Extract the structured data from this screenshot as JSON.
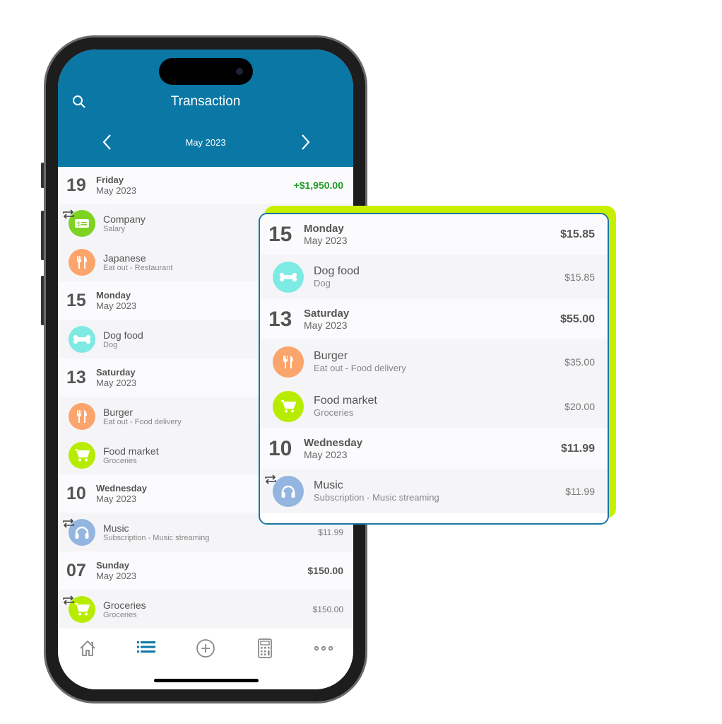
{
  "header": {
    "title": "Transaction",
    "month": "May 2023"
  },
  "colors": {
    "header": "#0a77a5",
    "accent": "#c7f000",
    "income": "#1e9a2a"
  },
  "phone_list": [
    {
      "type": "day",
      "num": "19",
      "name": "Friday",
      "sub": "May 2023",
      "amount": "+$1,950.00",
      "positive": true
    },
    {
      "type": "item",
      "name": "Company",
      "sub": "Salary",
      "icon": "salary-icon",
      "color": "#7ed321",
      "recurring": true
    },
    {
      "type": "item",
      "name": "Japanese",
      "sub": "Eat out  - Restaurant",
      "icon": "fork-knife-icon",
      "color": "#fba46b"
    },
    {
      "type": "day",
      "num": "15",
      "name": "Monday",
      "sub": "May 2023"
    },
    {
      "type": "item",
      "name": "Dog food",
      "sub": "Dog",
      "icon": "bone-icon",
      "color": "#7eeae4"
    },
    {
      "type": "day",
      "num": "13",
      "name": "Saturday",
      "sub": "May 2023"
    },
    {
      "type": "item",
      "name": "Burger",
      "sub": "Eat out  - Food delivery",
      "icon": "fork-knife-icon",
      "color": "#fba46b"
    },
    {
      "type": "item",
      "name": "Food market",
      "sub": "Groceries",
      "icon": "cart-icon",
      "color": "#b7ec00"
    },
    {
      "type": "day",
      "num": "10",
      "name": "Wednesday",
      "sub": "May 2023"
    },
    {
      "type": "item",
      "name": "Music",
      "sub": "Subscription  - Music streaming",
      "amount": "$11.99",
      "icon": "headphones-icon",
      "color": "#93b5e0",
      "recurring": true
    },
    {
      "type": "day",
      "num": "07",
      "name": "Sunday",
      "sub": "May 2023",
      "amount": "$150.00"
    },
    {
      "type": "item",
      "name": "Groceries",
      "sub": "Groceries",
      "amount": "$150.00",
      "icon": "cart-icon",
      "color": "#b7ec00",
      "recurring": true
    }
  ],
  "card_list": [
    {
      "type": "day",
      "num": "15",
      "name": "Monday",
      "sub": "May 2023",
      "amount": "$15.85"
    },
    {
      "type": "item",
      "name": "Dog food",
      "sub": "Dog",
      "amount": "$15.85",
      "icon": "bone-icon",
      "color": "#7eeae4"
    },
    {
      "type": "day",
      "num": "13",
      "name": "Saturday",
      "sub": "May 2023",
      "amount": "$55.00"
    },
    {
      "type": "item",
      "name": "Burger",
      "sub": "Eat out  - Food delivery",
      "amount": "$35.00",
      "icon": "fork-knife-icon",
      "color": "#fba46b"
    },
    {
      "type": "item",
      "name": "Food market",
      "sub": "Groceries",
      "amount": "$20.00",
      "icon": "cart-icon",
      "color": "#b7ec00"
    },
    {
      "type": "day",
      "num": "10",
      "name": "Wednesday",
      "sub": "May 2023",
      "amount": "$11.99"
    },
    {
      "type": "item",
      "name": "Music",
      "sub": "Subscription  - Music streaming",
      "amount": "$11.99",
      "icon": "headphones-icon",
      "color": "#93b5e0",
      "recurring": true
    }
  ],
  "tabbar": [
    {
      "icon": "home-icon"
    },
    {
      "icon": "list-icon",
      "active": true
    },
    {
      "icon": "add-circle-icon"
    },
    {
      "icon": "calculator-icon"
    },
    {
      "icon": "more-icon"
    }
  ]
}
